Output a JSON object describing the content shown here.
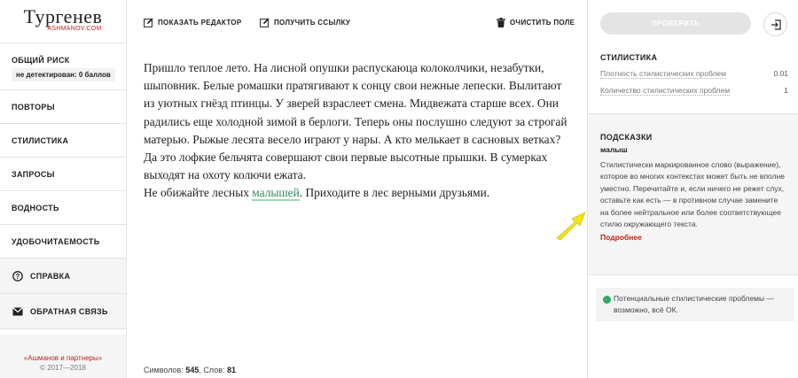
{
  "app": {
    "logo_title": "Тургенев",
    "logo_sub": "ASHMANOV.COM"
  },
  "risk": {
    "title": "ОБЩИЙ РИСК",
    "badge": "не детектирован: 0 баллов"
  },
  "nav": {
    "items": [
      {
        "label": "ПОВТОРЫ"
      },
      {
        "label": "СТИЛИСТИКА"
      },
      {
        "label": "ЗАПРОСЫ"
      },
      {
        "label": "ВОДНОСТЬ"
      },
      {
        "label": "УДОБОЧИТАЕМОСТЬ"
      }
    ],
    "help": "СПРАВКА",
    "feedback": "ОБРАТНАЯ СВЯЗЬ"
  },
  "footer": {
    "company": "«Ашманов и партнеры»",
    "copyright": "© 2017—2018"
  },
  "toolbar": {
    "show_editor": "ПОКАЗАТЬ РЕДАКТОР",
    "get_link": "ПОЛУЧИТЬ ССЫЛКУ",
    "clear": "ОЧИСТИТЬ ПОЛЕ"
  },
  "editor": {
    "paragraph1": "Пришло теплое лето. На лисной опушки распускаюца колоколчики, незабутки, шыповник. Белые ромашки пратягивают к сонцу свои нежные лепески. Вылитают из уютных гнёзд птинцы. У зверей взраслеет смена. Мидвежата старше всех. Они радились еще холодной зимой в берлоги. Теперь оны послушно следуют за строгай матерью. Рыжые лесята весело играют у нары. А кто мелькает в сасновых ветках? Да это лофкие бельчята совершают свои первые высотные прышки. В сумерках выходят на охоту колючи ежата.",
    "line2_before": "Не обижайте лесных ",
    "line2_highlight": "малышей",
    "line2_after": ". Приходите в лес верными друзьями."
  },
  "counter": {
    "chars_label": "Символов: ",
    "chars": "545",
    "words_label": ", Слов: ",
    "words": "81"
  },
  "right": {
    "check_button": "ПРОВЕРИТЬ",
    "stylistics_title": "СТИЛИСТИКА",
    "metrics": [
      {
        "label": "Плотность стилистических проблем",
        "value": "0.01"
      },
      {
        "label": "Количество стилистических проблем",
        "value": "1"
      }
    ],
    "hints_title": "ПОДСКАЗКИ",
    "hint_word": "малыш",
    "hint_text": "Стилистически маркированное слово (выражение), которое во многих контекстах может быть не вполне уместно. Перечитайте и, если ничего не режет слух, оставьте как есть — в противном случае замените на более нейтральное или более соответствующее стилю окружающего текста.",
    "hint_more": "Подробнее",
    "status_text": "Потенциальные стилистические проблемы — возможно, всё ОК."
  },
  "colors": {
    "brand_red": "#b8261c",
    "ok_green": "#2fae60",
    "highlight_green": "#2e8b57",
    "arrow_yellow": "#f2e21a"
  },
  "icons": [
    "edit-icon",
    "link-edit-icon",
    "trash-icon",
    "question-icon",
    "mail-icon",
    "login-icon",
    "pointer-arrow"
  ]
}
